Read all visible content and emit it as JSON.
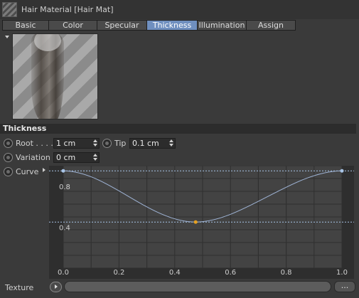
{
  "window": {
    "title": "Hair Material [Hair Mat]"
  },
  "tabs": [
    {
      "label": "Basic"
    },
    {
      "label": "Color"
    },
    {
      "label": "Specular"
    },
    {
      "label": "Thickness"
    },
    {
      "label": "Illumination"
    },
    {
      "label": "Assign"
    }
  ],
  "active_tab": "Thickness",
  "section": {
    "title": "Thickness"
  },
  "params": {
    "root": {
      "label": "Root . . . .",
      "value": "1 cm"
    },
    "tip": {
      "label": "Tip",
      "value": "0.1 cm"
    },
    "variation": {
      "label": "Variation",
      "value": "0 cm"
    },
    "curve": {
      "label": "Curve"
    }
  },
  "texture": {
    "label": "Texture",
    "more_label": "..."
  },
  "colors": {
    "active_tab": "#6f8fbf",
    "curve": "#9fb4d6",
    "selected_point": "#e6a020"
  },
  "chart_data": {
    "type": "line",
    "x": [
      0.0,
      0.475,
      1.0
    ],
    "y": [
      0.95,
      0.45,
      0.95
    ],
    "selected_index": 1,
    "xlim": [
      0.0,
      1.0
    ],
    "ylim": [
      0.0,
      1.0
    ],
    "xticks": [
      "0.0",
      "0.2",
      "0.4",
      "0.6",
      "0.8",
      "1.0"
    ],
    "yticks": [
      "0.4",
      "0.8"
    ],
    "grid": true
  }
}
